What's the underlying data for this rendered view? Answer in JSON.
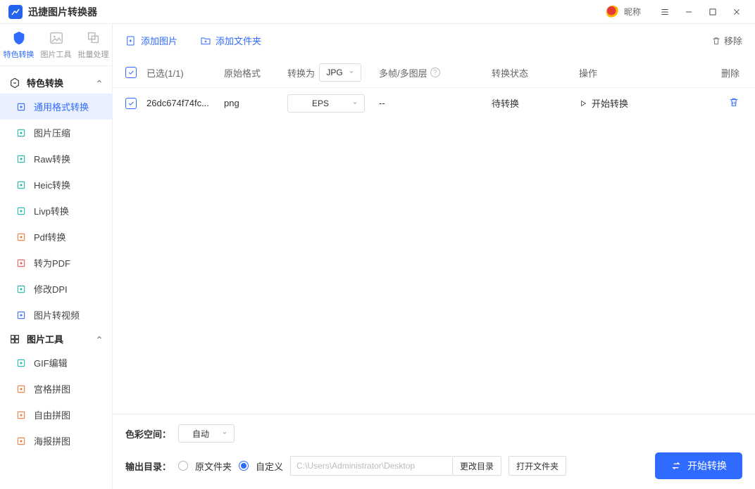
{
  "app": {
    "title": "迅捷图片转换器",
    "nick": "昵称"
  },
  "topTabs": [
    {
      "label": "特色转换",
      "active": true
    },
    {
      "label": "图片工具",
      "active": false
    },
    {
      "label": "批量处理",
      "active": false
    }
  ],
  "sidebar": {
    "group1": {
      "title": "特色转换"
    },
    "items1": [
      {
        "label": "通用格式转换",
        "active": true,
        "color": "#2f6bff"
      },
      {
        "label": "图片压缩",
        "color": "#18b6a6"
      },
      {
        "label": "Raw转换",
        "color": "#18b6a6"
      },
      {
        "label": "Heic转换",
        "color": "#18b6a6"
      },
      {
        "label": "Livp转换",
        "color": "#18b6a6"
      },
      {
        "label": "Pdf转换",
        "color": "#f07735"
      },
      {
        "label": "转为PDF",
        "color": "#f05050"
      },
      {
        "label": "修改DPI",
        "color": "#18b6a6"
      },
      {
        "label": "图片转视频",
        "color": "#2f6bff"
      }
    ],
    "group2": {
      "title": "图片工具"
    },
    "items2": [
      {
        "label": "GIF编辑",
        "color": "#18b6a6"
      },
      {
        "label": "宫格拼图",
        "color": "#f07735"
      },
      {
        "label": "自由拼图",
        "color": "#f07735"
      },
      {
        "label": "海报拼图",
        "color": "#f07735"
      }
    ]
  },
  "toolbar": {
    "addImage": "添加图片",
    "addFolder": "添加文件夹",
    "remove": "移除"
  },
  "table": {
    "headers": {
      "selected": "已选(1/1)",
      "origFmt": "原始格式",
      "convertTo": "转换为",
      "convertToValue": "JPG",
      "multi": "多帧/多图层",
      "state": "转换状态",
      "op": "操作",
      "del": "删除"
    },
    "rows": [
      {
        "name": "26dc674f74fc...",
        "fmt": "png",
        "target": "EPS",
        "layer": "--",
        "state": "待转换",
        "op": "开始转换"
      }
    ]
  },
  "footer": {
    "colorSpace": {
      "label": "色彩空间：",
      "value": "自动"
    },
    "outDir": {
      "label": "输出目录：",
      "srcLabel": "原文件夹",
      "customLabel": "自定义",
      "path": "C:\\Users\\Administrator\\Desktop",
      "changeBtn": "更改目录",
      "openBtn": "打开文件夹"
    },
    "start": "开始转换"
  }
}
